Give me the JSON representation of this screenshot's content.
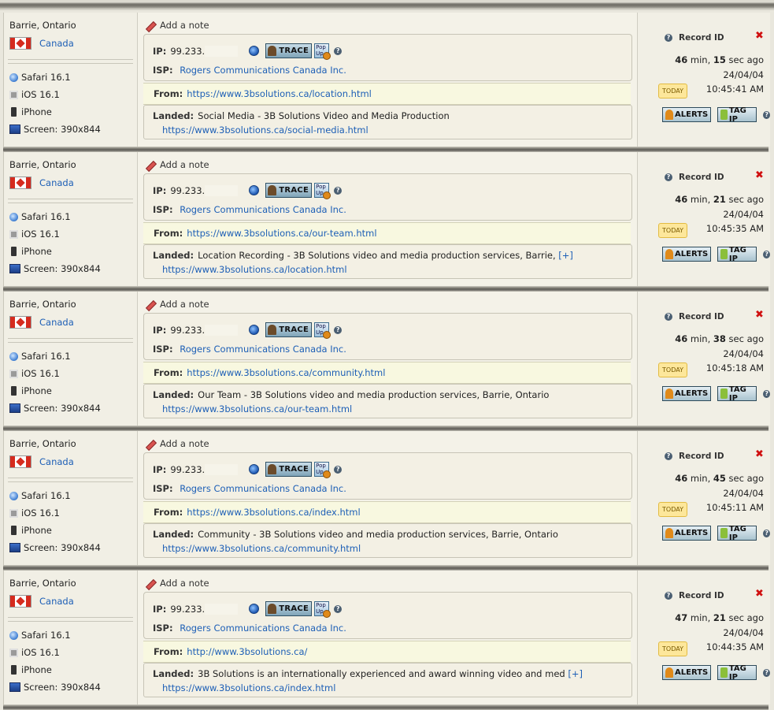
{
  "note_label": "Add a note",
  "trace_label": "TRACE",
  "popup_label": "Pop Up",
  "help_glyph": "?",
  "delete_glyph": "✖",
  "record_id_label": "Record ID",
  "today_label": "TODAY",
  "alerts_label": "ALERTS",
  "tagip_label": "TAG IP",
  "more_label": "[+]",
  "labels": {
    "ip": "IP:",
    "isp": "ISP:",
    "from": "From:",
    "landed": "Landed:"
  },
  "records": [
    {
      "location": "Barrie, Ontario",
      "country": "Canada",
      "browser": "Safari 16.1",
      "os": "iOS 16.1",
      "device": "iPhone",
      "screen": "Screen: 390x844",
      "ip": "99.233.",
      "isp": "Rogers Communications Canada Inc.",
      "from_url": "https://www.3bsolutions.ca/location.html",
      "landed_title": "Social Media - 3B Solutions Video and Media Production",
      "landed_more": false,
      "landed_url": "https://www.3bsolutions.ca/social-media.html",
      "ago_min": "46",
      "ago_sec": "15",
      "date": "24/04/04",
      "time": "10:45:41 AM"
    },
    {
      "location": "Barrie, Ontario",
      "country": "Canada",
      "browser": "Safari 16.1",
      "os": "iOS 16.1",
      "device": "iPhone",
      "screen": "Screen: 390x844",
      "ip": "99.233.",
      "isp": "Rogers Communications Canada Inc.",
      "from_url": "https://www.3bsolutions.ca/our-team.html",
      "landed_title": "Location Recording - 3B Solutions video and media production services, Barrie,",
      "landed_more": true,
      "landed_url": "https://www.3bsolutions.ca/location.html",
      "ago_min": "46",
      "ago_sec": "21",
      "date": "24/04/04",
      "time": "10:45:35 AM"
    },
    {
      "location": "Barrie, Ontario",
      "country": "Canada",
      "browser": "Safari 16.1",
      "os": "iOS 16.1",
      "device": "iPhone",
      "screen": "Screen: 390x844",
      "ip": "99.233.",
      "isp": "Rogers Communications Canada Inc.",
      "from_url": "https://www.3bsolutions.ca/community.html",
      "landed_title": "Our Team - 3B Solutions video and media production services, Barrie, Ontario",
      "landed_more": false,
      "landed_url": "https://www.3bsolutions.ca/our-team.html",
      "ago_min": "46",
      "ago_sec": "38",
      "date": "24/04/04",
      "time": "10:45:18 AM"
    },
    {
      "location": "Barrie, Ontario",
      "country": "Canada",
      "browser": "Safari 16.1",
      "os": "iOS 16.1",
      "device": "iPhone",
      "screen": "Screen: 390x844",
      "ip": "99.233.",
      "isp": "Rogers Communications Canada Inc.",
      "from_url": "https://www.3bsolutions.ca/index.html",
      "landed_title": "Community - 3B Solutions video and media production services, Barrie, Ontario",
      "landed_more": false,
      "landed_url": "https://www.3bsolutions.ca/community.html",
      "ago_min": "46",
      "ago_sec": "45",
      "date": "24/04/04",
      "time": "10:45:11 AM"
    },
    {
      "location": "Barrie, Ontario",
      "country": "Canada",
      "browser": "Safari 16.1",
      "os": "iOS 16.1",
      "device": "iPhone",
      "screen": "Screen: 390x844",
      "ip": "99.233.",
      "isp": "Rogers Communications Canada Inc.",
      "from_url": "http://www.3bsolutions.ca/",
      "landed_title": "3B Solutions is an internationally experienced and award winning video and med",
      "landed_more": true,
      "landed_url": "https://www.3bsolutions.ca/index.html",
      "ago_min": "47",
      "ago_sec": "21",
      "date": "24/04/04",
      "time": "10:44:35 AM"
    }
  ]
}
